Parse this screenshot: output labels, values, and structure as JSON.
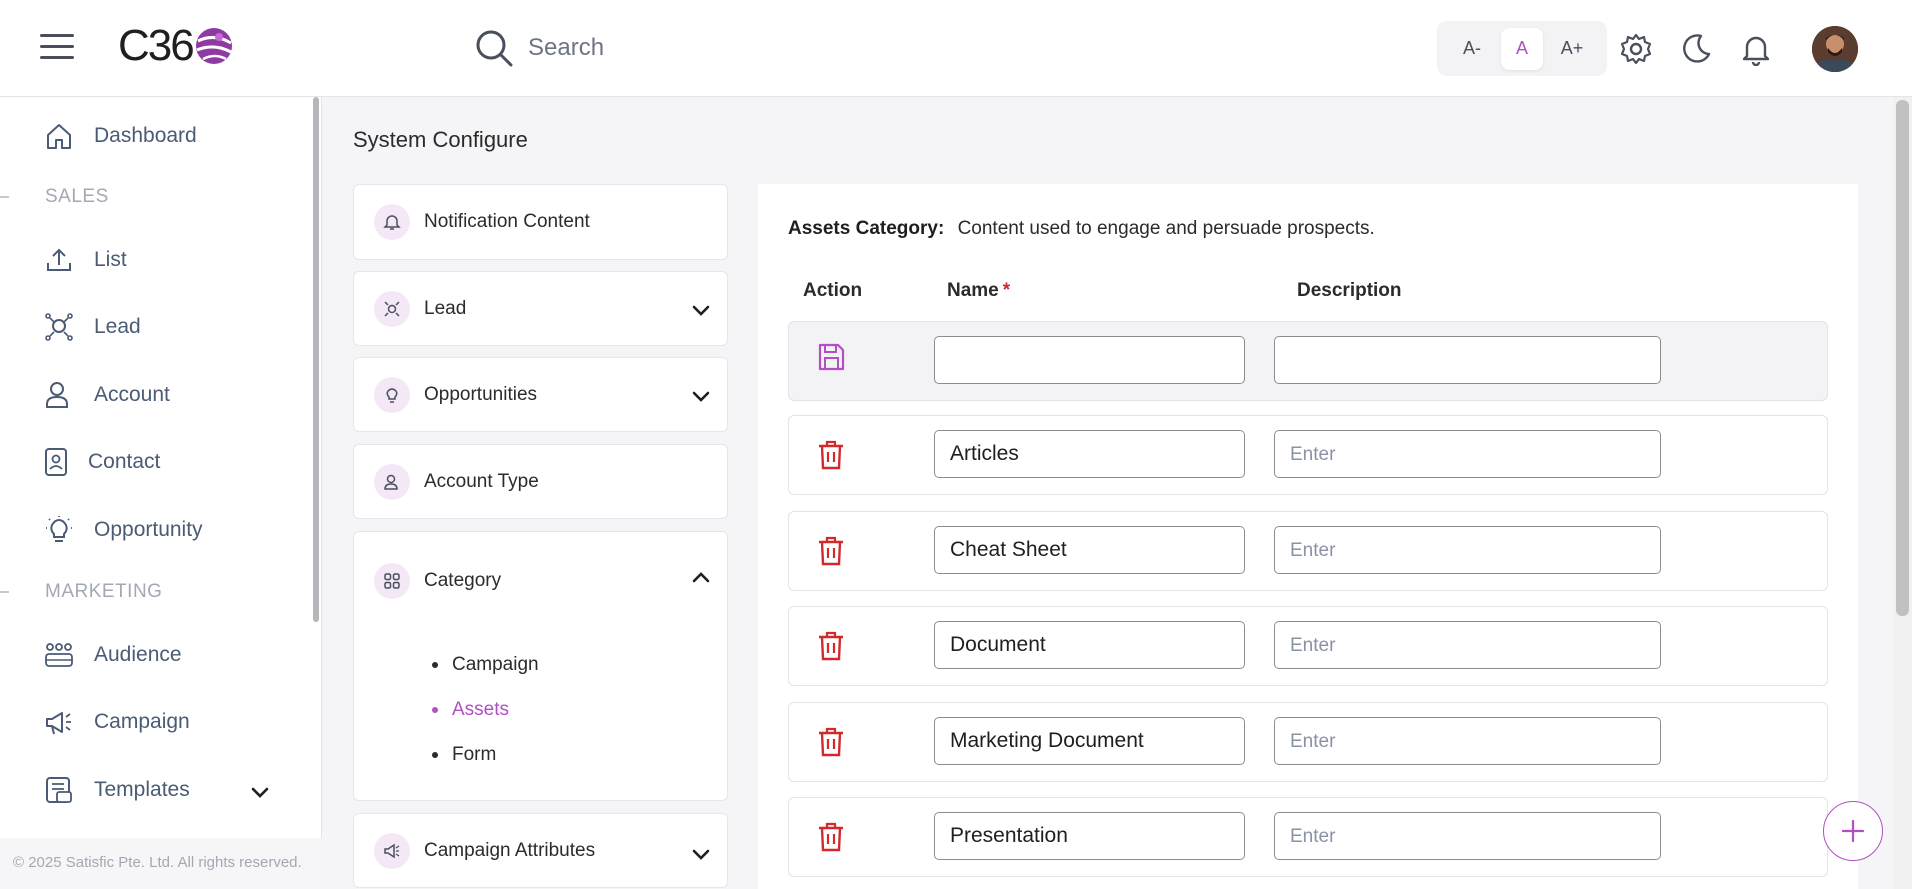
{
  "header": {
    "logo_text": "C36",
    "search_placeholder": "Search",
    "font_sizes": [
      "A-",
      "A",
      "A+"
    ],
    "active_font_size": "A"
  },
  "sidebar": {
    "items": [
      {
        "label": "Dashboard",
        "icon": "home-icon"
      },
      {
        "label": "List",
        "icon": "upload-icon"
      },
      {
        "label": "Lead",
        "icon": "lead-icon"
      },
      {
        "label": "Account",
        "icon": "account-icon"
      },
      {
        "label": "Contact",
        "icon": "contact-icon"
      },
      {
        "label": "Opportunity",
        "icon": "bulb-icon"
      },
      {
        "label": "Audience",
        "icon": "audience-icon"
      },
      {
        "label": "Campaign",
        "icon": "megaphone-icon"
      },
      {
        "label": "Templates",
        "icon": "templates-icon"
      }
    ],
    "sections": [
      "SALES",
      "MARKETING"
    ],
    "footer": "© 2025 Satisfic Pte. Ltd. All rights reserved."
  },
  "main": {
    "title": "System Configure",
    "config_items": [
      {
        "label": "Notification Content"
      },
      {
        "label": "Lead"
      },
      {
        "label": "Opportunities"
      },
      {
        "label": "Account Type"
      },
      {
        "label": "Category"
      },
      {
        "label": "Campaign Attributes"
      }
    ],
    "category_sub_items": [
      "Campaign",
      "Assets",
      "Form"
    ],
    "active_sub_item": "Assets"
  },
  "assets": {
    "heading": "Assets Category:",
    "description": "Content used to engage and persuade prospects.",
    "columns": {
      "action": "Action",
      "name": "Name",
      "required_mark": "*",
      "description": "Description"
    },
    "desc_placeholder": "Enter",
    "rows": [
      {
        "name": "Articles"
      },
      {
        "name": "Cheat Sheet"
      },
      {
        "name": "Document"
      },
      {
        "name": "Marketing Document"
      },
      {
        "name": "Presentation"
      }
    ]
  },
  "colors": {
    "accent": "#b24fc4",
    "delete": "#d12a2a",
    "sidebar_text": "#4a5b74"
  }
}
